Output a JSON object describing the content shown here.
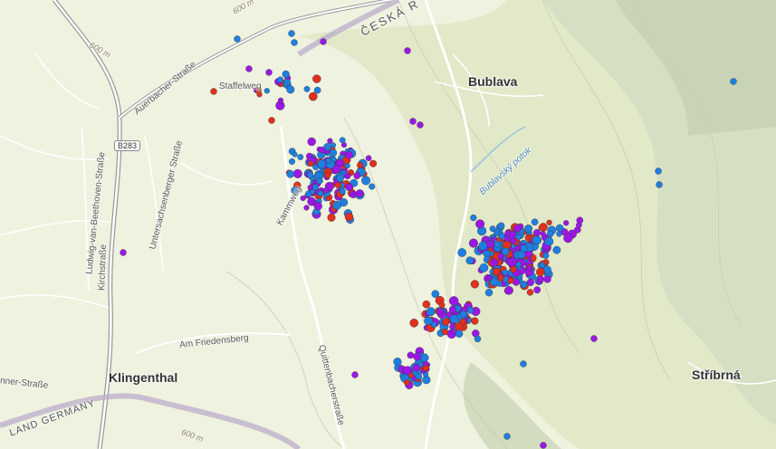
{
  "map": {
    "colors": {
      "background": "#eef2df",
      "forest": "#e1e9c8",
      "hill": "#cfd8bd",
      "road_major": "#9a9a9a",
      "road_minor": "#ffffff",
      "border": "#b9a8c9",
      "blue": "#1f7fe0",
      "purple": "#9b17e6",
      "red": "#e0301e"
    },
    "labels": {
      "bublava": "Bublava",
      "klingenthal": "Klingenthal",
      "stribrna": "Stříbrná",
      "ceska": "ČESKÁ R",
      "germany": "LAND GERMANY",
      "auerbacher": "Auerbacher-Straße",
      "staffelweg": "Staffelweg",
      "kammweg": "Kammweg",
      "beethoven": "Ludwig-van-Beethoven-Straße",
      "kirchstrasse": "Kirchstraße",
      "untersachsenberger": "Untersachsenberger Straße",
      "friedensberg": "Am Friedensberg",
      "quittenbacher": "Quittenbacherstraße",
      "brunner": "nner-Straße",
      "bublavsky": "Bublavský potok",
      "b283": "B283",
      "contour_600_a": "600 m",
      "contour_600_b": "600 m",
      "contour_600_c": "600 m"
    }
  }
}
